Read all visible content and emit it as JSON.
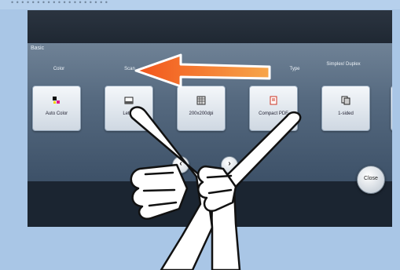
{
  "header_strip": "• • • • • • • • • • • • • • • • • • •",
  "panel": {
    "title": "Basic",
    "column_headers": {
      "color": "Color",
      "scan": "Scan",
      "type": "Type",
      "simplex_duplex": "Simplex/ Duplex"
    },
    "buttons": [
      {
        "label": "Auto Color",
        "icon": "color-icon"
      },
      {
        "label": "Letter",
        "icon": "paper-icon"
      },
      {
        "label": "200x200dpi",
        "icon": "resolution-icon"
      },
      {
        "label": "Compact PDF",
        "icon": "pdf-icon"
      },
      {
        "label": "1-sided",
        "icon": "duplex-icon"
      }
    ],
    "nav_prev": "‹",
    "nav_next": "›"
  },
  "close_button": "Close",
  "gesture": {
    "type": "two-finger swipe",
    "direction": "left",
    "arrow_color": "#ef5a1f"
  }
}
